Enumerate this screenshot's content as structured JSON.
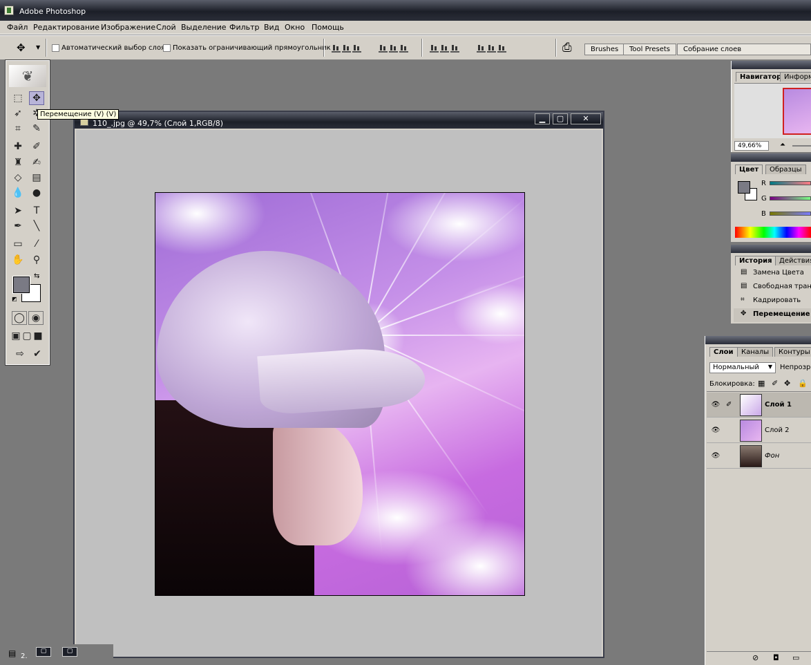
{
  "app": {
    "title": "Adobe Photoshop"
  },
  "menu": [
    "Файл",
    "Редактирование",
    "Изображение",
    "Слой",
    "Выделение",
    "Фильтр",
    "Вид",
    "Окно",
    "Помощь"
  ],
  "options": {
    "auto_select": "Автоматический выбор слоя",
    "show_bounds": "Показать ограничивающий прямоугольник",
    "wells": [
      "Brushes",
      "Tool Presets",
      "Собрание слоев"
    ]
  },
  "tooltip": "Перемещение (V) (V)",
  "document": {
    "title": "110_.jpg @ 49,7% (Слой 1,RGB/8)"
  },
  "navigator": {
    "tabs": [
      "Навигатор",
      "Информация"
    ],
    "zoom": "49,66%"
  },
  "color": {
    "tabs": [
      "Цвет",
      "Образцы"
    ],
    "channels": [
      "R",
      "G",
      "B"
    ],
    "fg": "#7a7a84",
    "bg": "#ffffff"
  },
  "history": {
    "tabs": [
      "История",
      "Действия"
    ],
    "items": [
      "Замена Цвета",
      "Свободная трансф.",
      "Кадрировать",
      "Перемещение"
    ]
  },
  "layers": {
    "tabs": [
      "Слои",
      "Каналы",
      "Контуры"
    ],
    "blend": "Нормальный",
    "opacity_label": "Непрозрачность",
    "lock_label": "Блокировка:",
    "items": [
      {
        "name": "Слой 1"
      },
      {
        "name": "Слой 2"
      },
      {
        "name": "Фон"
      }
    ]
  },
  "taskbar": {
    "label": "2."
  }
}
